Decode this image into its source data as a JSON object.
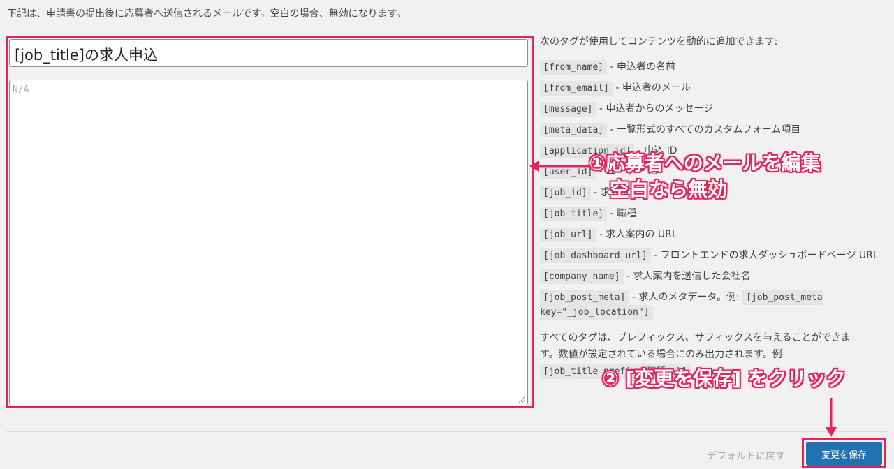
{
  "intro_text": "下記は、申請書の提出後に応募者へ送信されるメールです。空白の場合、無効になります。",
  "subject_value": "[job_title]の求人申込",
  "body_placeholder": "N/A",
  "tags_intro": "次のタグが使用してコンテンツを動的に追加できます:",
  "tags": [
    {
      "code": "[from_name]",
      "desc": " - 申込者の名前"
    },
    {
      "code": "[from_email]",
      "desc": " - 申込者のメール"
    },
    {
      "code": "[message]",
      "desc": " - 申込者からのメッセージ"
    },
    {
      "code": "[meta_data]",
      "desc": " - 一覧形式のすべてのカスタムフォーム項目"
    },
    {
      "code": "[application_id]",
      "desc": " - 申込 ID"
    },
    {
      "code": "[user_id]",
      "desc": " - ユーザー ID"
    },
    {
      "code": "[job_id]",
      "desc": " - 求人 ID"
    },
    {
      "code": "[job_title]",
      "desc": " - 職種"
    },
    {
      "code": "[job_url]",
      "desc": " - 求人案内の URL"
    },
    {
      "code": "[job_dashboard_url]",
      "desc": " - フロントエンドの求人ダッシュボードページ URL"
    },
    {
      "code": "[company_name]",
      "desc": " - 求人案内を送信した会社名"
    },
    {
      "code": "[job_post_meta]",
      "desc": " - 求人のメタデータ。例: ",
      "code2": "[job_post_meta key=\"_job_location\"]"
    }
  ],
  "note_text": "すべてのタグは、プレフィックス、サフィックスを与えることができます。数値が設定されている場合にのみ出力されます。例",
  "note_code": "[job_title prefix=\"職種: \"]",
  "reset_label": "デフォルトに戻す",
  "save_label": "変更を保存",
  "annotations": {
    "callout1_line1": "①応募者へのメールを編集",
    "callout1_line2": "空白なら無効",
    "callout2": "② [変更を保存] をクリック",
    "color": "#e6245a"
  }
}
